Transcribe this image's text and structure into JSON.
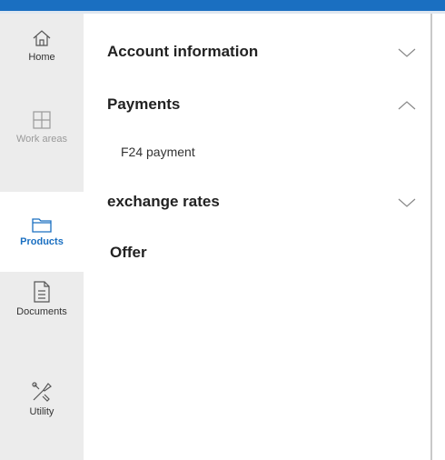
{
  "rail": {
    "items": [
      {
        "label": "Home",
        "icon": "home-icon",
        "state": "normal"
      },
      {
        "label": "Work areas",
        "icon": "grid-icon",
        "state": "disabled"
      },
      {
        "label": "Products",
        "icon": "folder-icon",
        "state": "active"
      },
      {
        "label": "Documents",
        "icon": "document-icon",
        "state": "normal"
      },
      {
        "label": "Utility",
        "icon": "tools-icon",
        "state": "normal"
      }
    ]
  },
  "menu": {
    "sections": [
      {
        "title": "Account information",
        "chevron": "down"
      },
      {
        "title": "Payments",
        "chevron": "up",
        "children": [
          "F24 payment"
        ]
      },
      {
        "title": "exchange rates",
        "chevron": "down"
      },
      {
        "title": "Offer"
      }
    ]
  },
  "colors": {
    "accent": "#1a6fc1",
    "rail_background": "#ececec",
    "disabled_text": "#9a9a9a"
  }
}
